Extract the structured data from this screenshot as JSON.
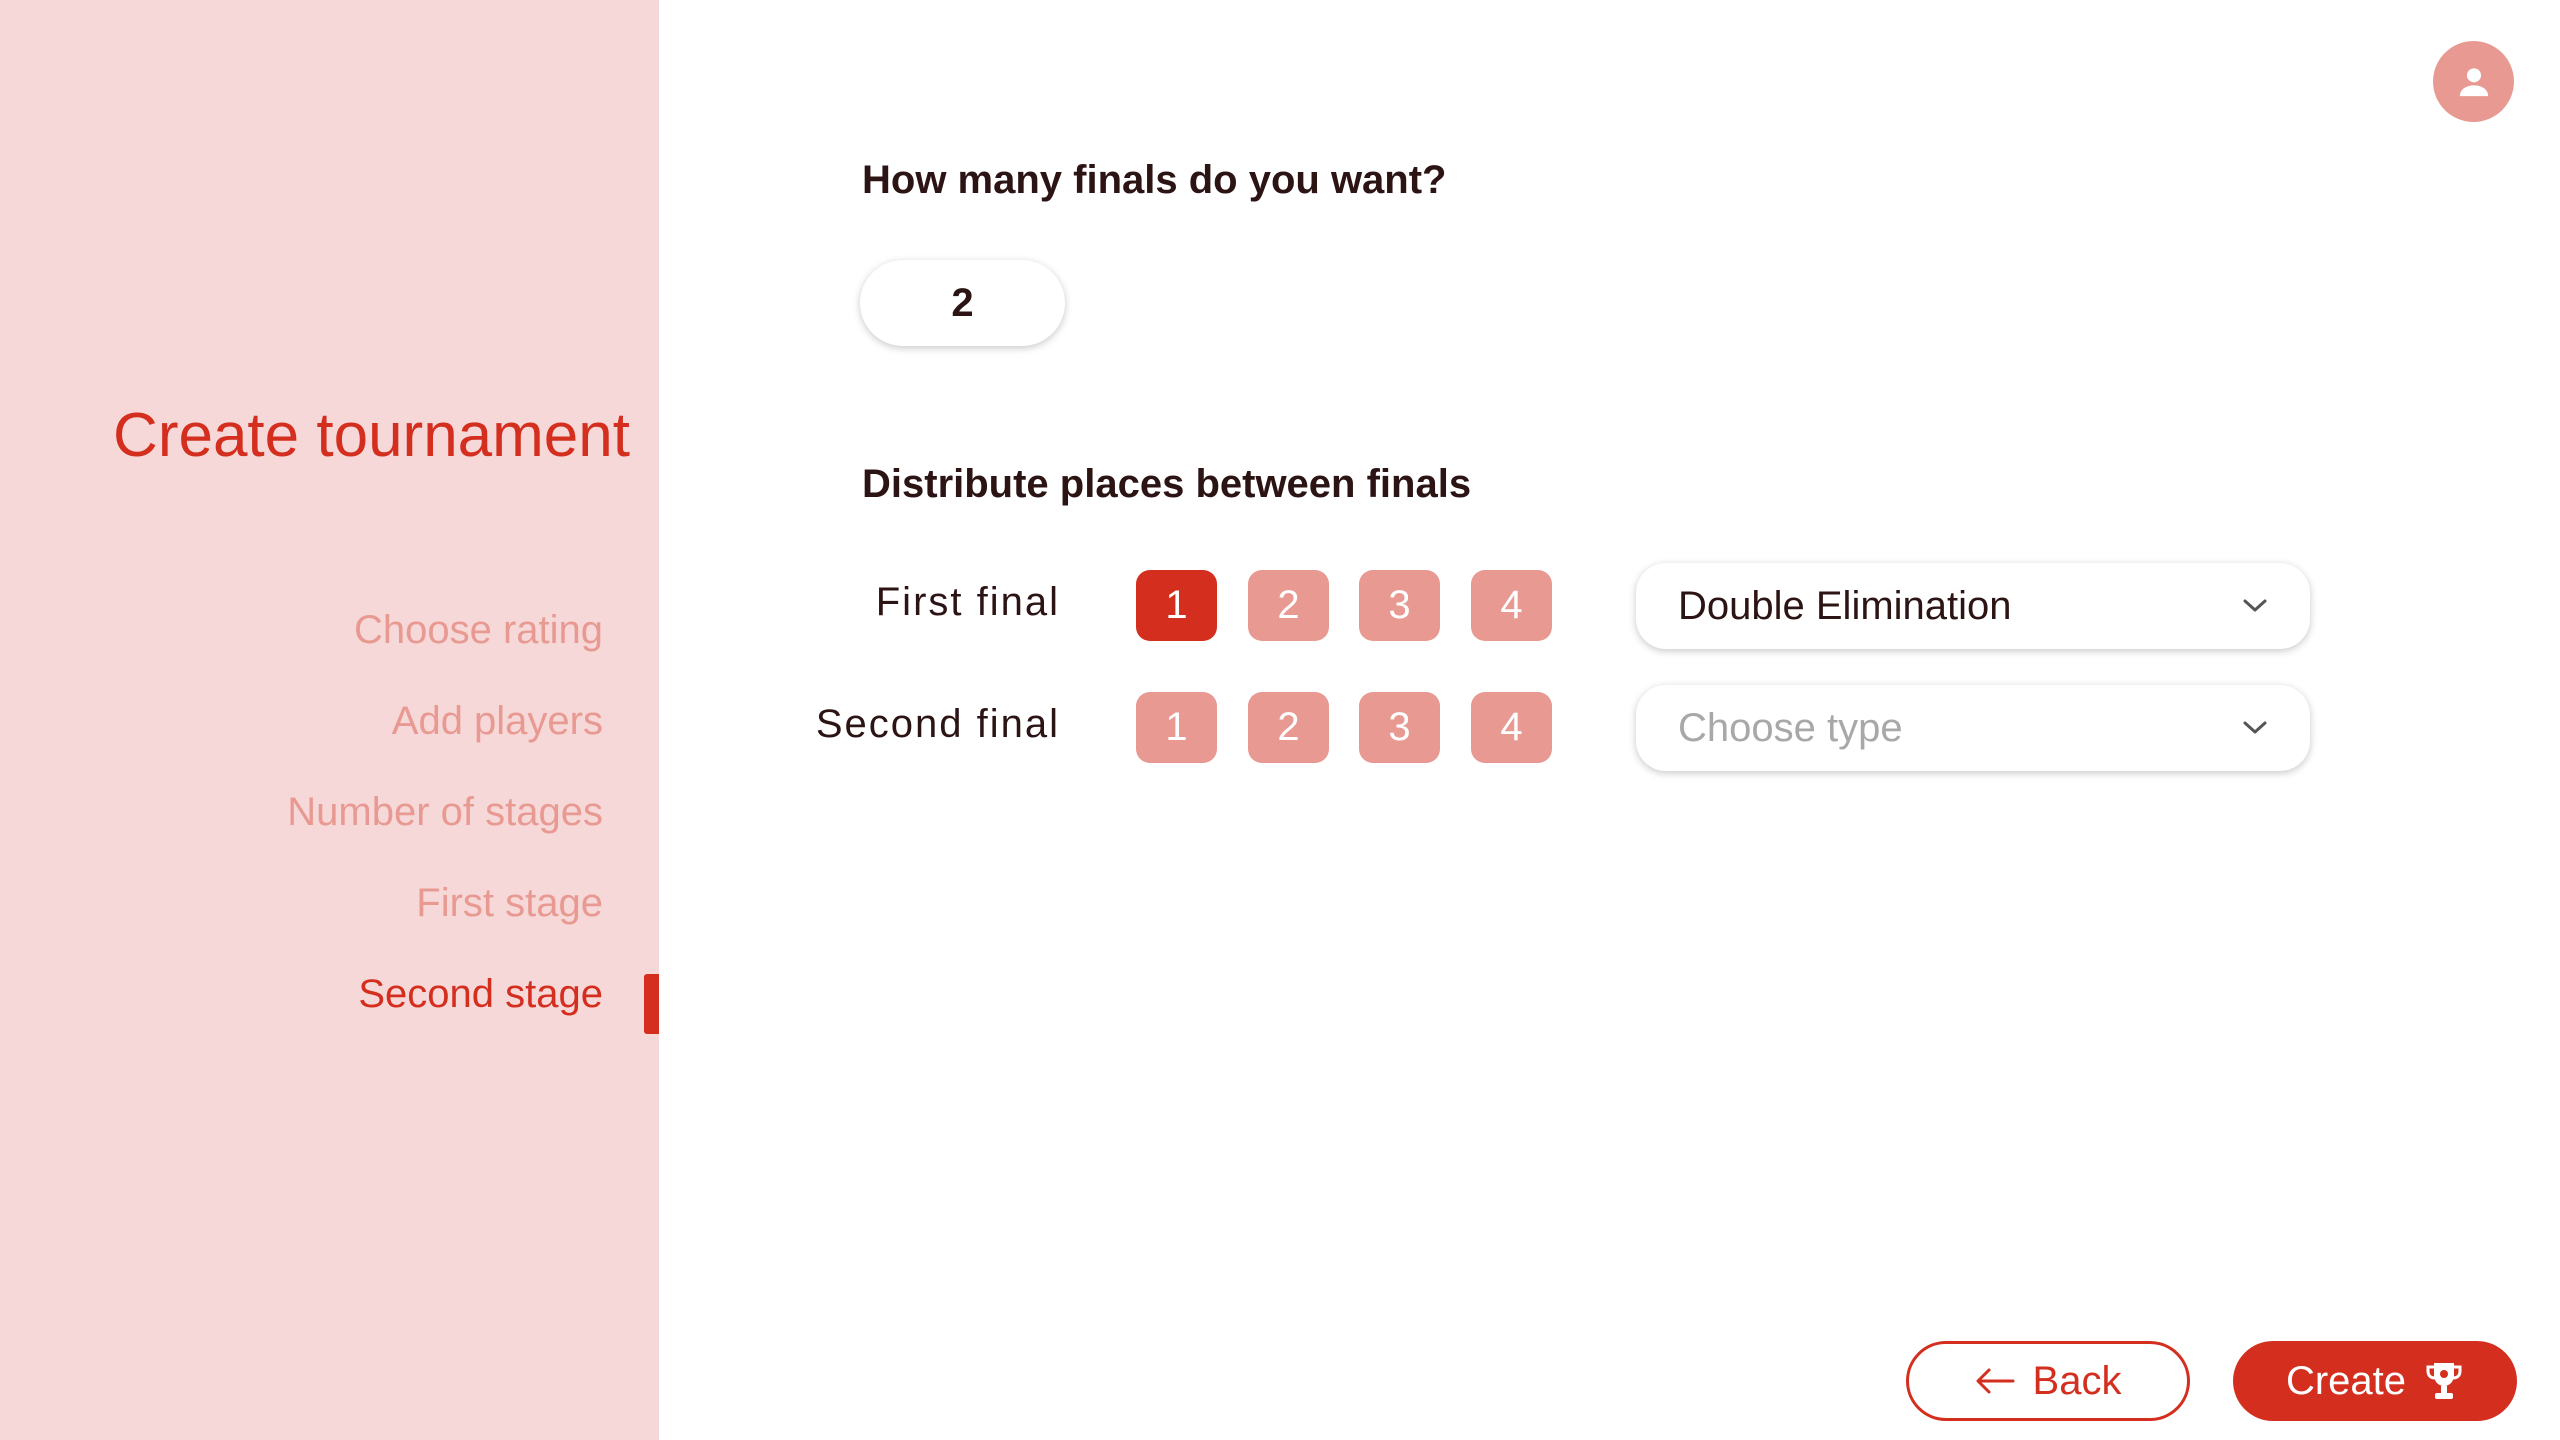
{
  "sidebar": {
    "title": "Create tournament",
    "steps": [
      {
        "label": "Choose rating",
        "active": false
      },
      {
        "label": "Add players",
        "active": false
      },
      {
        "label": "Number of stages",
        "active": false
      },
      {
        "label": "First stage",
        "active": false
      },
      {
        "label": "Second stage",
        "active": true
      }
    ]
  },
  "main": {
    "finals_question": "How many finals do you want?",
    "finals_count": "2",
    "distribute_heading": "Distribute places between finals",
    "finals": [
      {
        "label": "First final",
        "places": [
          "1",
          "2",
          "3",
          "4"
        ],
        "selected_places": [
          "1"
        ],
        "type_value": "Double Elimination",
        "type_placeholder": "Choose type"
      },
      {
        "label": "Second final",
        "places": [
          "1",
          "2",
          "3",
          "4"
        ],
        "selected_places": [],
        "type_value": "",
        "type_placeholder": "Choose type"
      }
    ]
  },
  "footer": {
    "back_label": "Back",
    "create_label": "Create"
  },
  "icons": {
    "avatar": "user-icon",
    "dropdown": "chevron-down-icon",
    "back": "arrow-left-icon",
    "create": "trophy-icon"
  },
  "colors": {
    "accent": "#d42e1f",
    "accent_light": "#e89a92",
    "sidebar_bg": "#f6d8d8",
    "text_dark": "#2c1414"
  }
}
